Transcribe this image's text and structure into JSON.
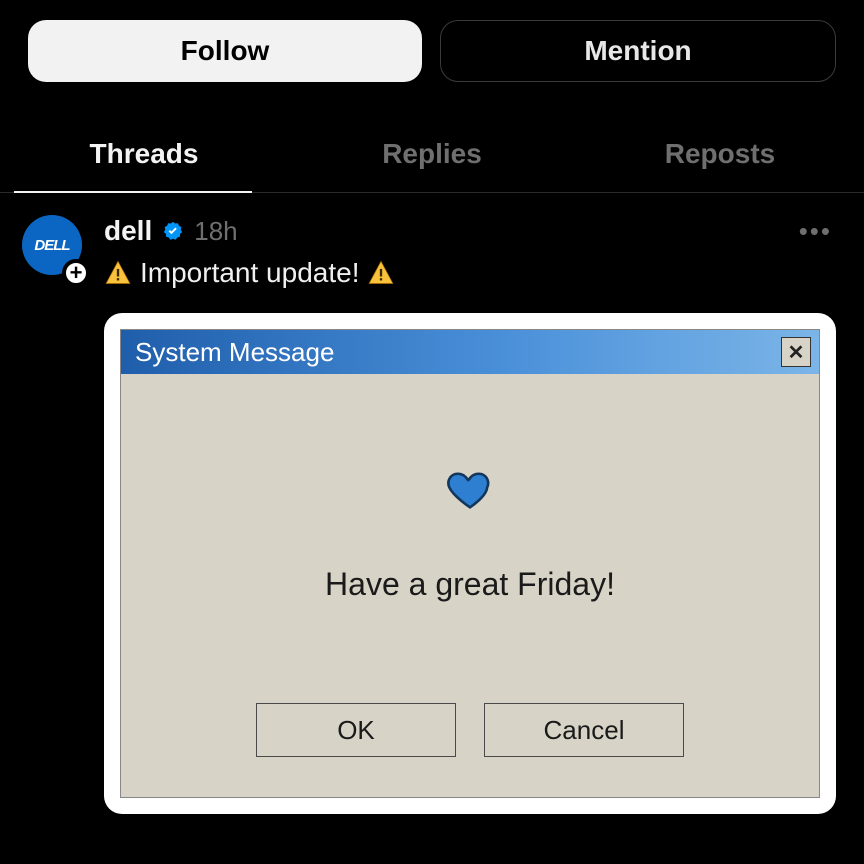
{
  "actions": {
    "follow_label": "Follow",
    "mention_label": "Mention"
  },
  "tabs": {
    "items": [
      {
        "label": "Threads",
        "active": true
      },
      {
        "label": "Replies",
        "active": false
      },
      {
        "label": "Reposts",
        "active": false
      }
    ]
  },
  "post": {
    "avatar_text": "DELL",
    "username": "dell",
    "verified": true,
    "timestamp": "18h",
    "text": "Important update!",
    "more_icon": "more-icon"
  },
  "card": {
    "titlebar": "System Message",
    "message": "Have a great Friday!",
    "ok_label": "OK",
    "cancel_label": "Cancel"
  }
}
